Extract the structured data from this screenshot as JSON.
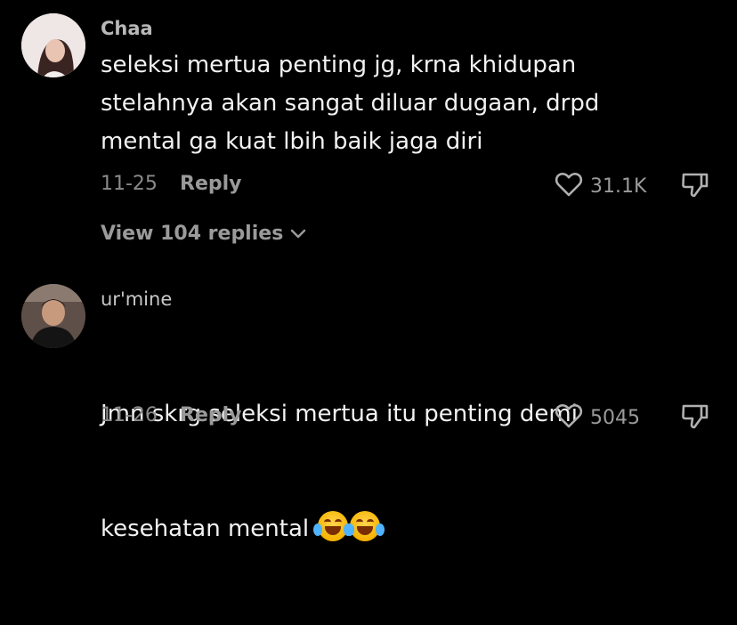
{
  "comments": [
    {
      "username": "Chaa",
      "text": "seleksi mertua penting jg, krna khidupan\nstelahnya akan sangat diluar dugaan, drpd\nmental ga kuat lbih baik jaga diri",
      "date": "11-25",
      "reply_label": "Reply",
      "likes": "31.1K",
      "view_replies": "View 104 replies"
    },
    {
      "username": "ur'mine",
      "text_line1": "Jmn skrg seleksi mertua itu penting demi",
      "text_line2": "kesehatan mental",
      "emojis": [
        "face-with-tears-of-joy",
        "face-with-tears-of-joy"
      ],
      "date": "11-26",
      "reply_label": "Reply",
      "likes": "5045"
    }
  ],
  "icons": {
    "like": "heart-outline-icon",
    "dislike": "thumbs-down-icon",
    "expand": "chevron-down-icon"
  },
  "colors": {
    "background": "#000000",
    "text": "#f2f2f2",
    "muted": "#8a8a8a"
  }
}
